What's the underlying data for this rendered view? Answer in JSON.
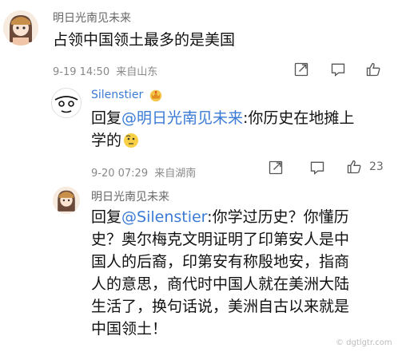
{
  "comments": [
    {
      "username": "明日光南见未来",
      "text": "占领中国领土最多的是美国",
      "date": "9-19 14:50",
      "location": "来自山东"
    },
    {
      "username": "Silenstier",
      "reply_prefix": "回复",
      "mention": "@明日光南见未来",
      "text_line1": ":你历史在地摊上",
      "text_line2": "学的",
      "date": "9-20 07:29",
      "location": "来自湖南",
      "like_count": "23"
    },
    {
      "username": "明日光南见未来",
      "reply_prefix": "回复",
      "mention": "@Silenstier",
      "text_line1": ":你学过历史？你懂历",
      "lines": [
        "史？奥尔梅克文明证明了印第安人是中",
        "国人的后裔，印第安有称殷地安，指商",
        "人的意思，商代时中国人就在美洲大陆",
        "生活了，换句话说，美洲自古以来就是",
        "中国领土！"
      ]
    }
  ],
  "icons": {
    "share": "share-icon",
    "comment": "comment-icon",
    "like": "thumbs-up-icon",
    "emoji": "thinking-emoji",
    "badge": "crown-badge-icon"
  },
  "watermark": "© dgtlgtr.com"
}
